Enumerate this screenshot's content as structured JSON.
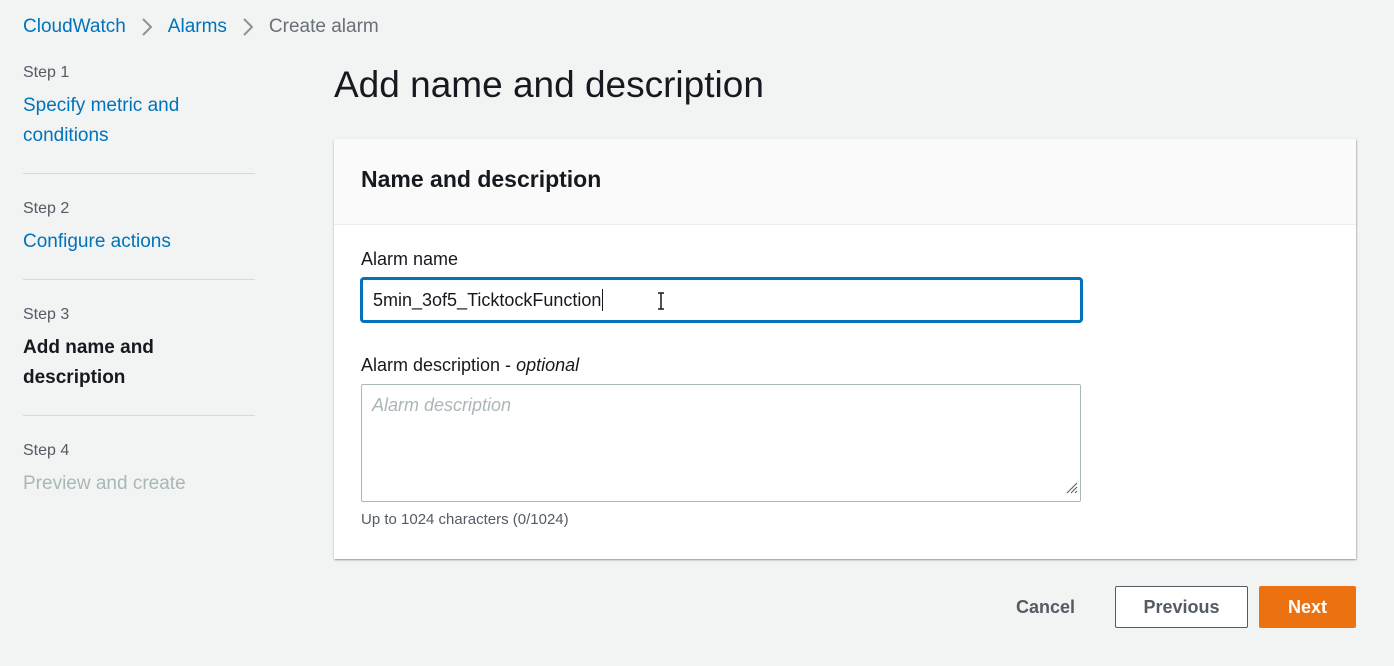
{
  "breadcrumb": {
    "items": [
      "CloudWatch",
      "Alarms"
    ],
    "current": "Create alarm"
  },
  "steps": [
    {
      "number": "Step 1",
      "title": "Specify metric and conditions"
    },
    {
      "number": "Step 2",
      "title": "Configure actions"
    },
    {
      "number": "Step 3",
      "title": "Add name and description"
    },
    {
      "number": "Step 4",
      "title": "Preview and create"
    }
  ],
  "page": {
    "title": "Add name and description"
  },
  "panel": {
    "title": "Name and description",
    "alarm_name": {
      "label": "Alarm name",
      "value": "5min_3of5_TicktockFunction"
    },
    "alarm_description": {
      "label": "Alarm description - ",
      "label_optional": "optional",
      "placeholder": "Alarm description",
      "hint": "Up to 1024 characters (0/1024)"
    }
  },
  "actions": {
    "cancel": "Cancel",
    "previous": "Previous",
    "next": "Next"
  },
  "colors": {
    "link": "#0073bb",
    "primary": "#ec7211",
    "background": "#f2f3f3"
  }
}
